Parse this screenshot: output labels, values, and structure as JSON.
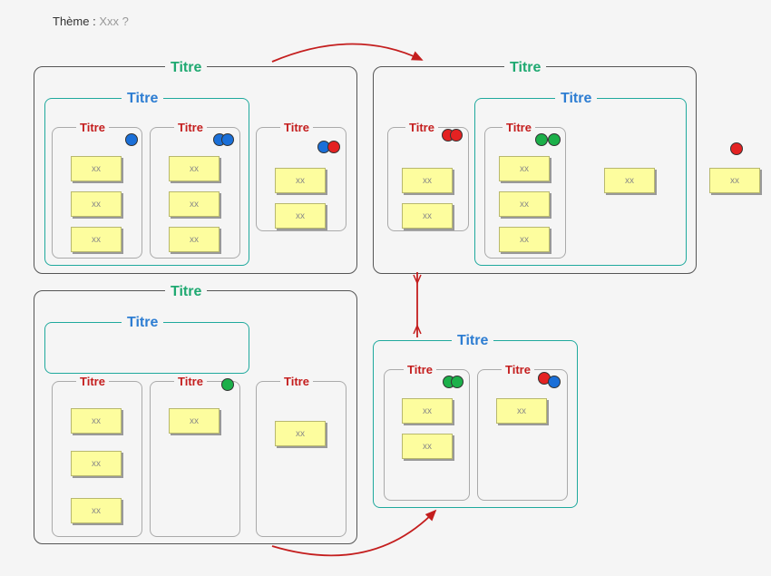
{
  "theme_label": "Thème :",
  "theme_value": "Xxx ?",
  "title_green": "Titre",
  "title_blue": "Titre",
  "title_red": "Titre",
  "sticky_text": "xx",
  "colors": {
    "green_title": "#1fa971",
    "blue_title": "#2d7dd2",
    "red_title": "#c41e1e",
    "teal_border": "#1fa99d",
    "sticky_bg": "#fdfd9e",
    "blue_dot": "#1a6fd8",
    "red_dot": "#e42222",
    "green_dot": "#1cb04a"
  }
}
